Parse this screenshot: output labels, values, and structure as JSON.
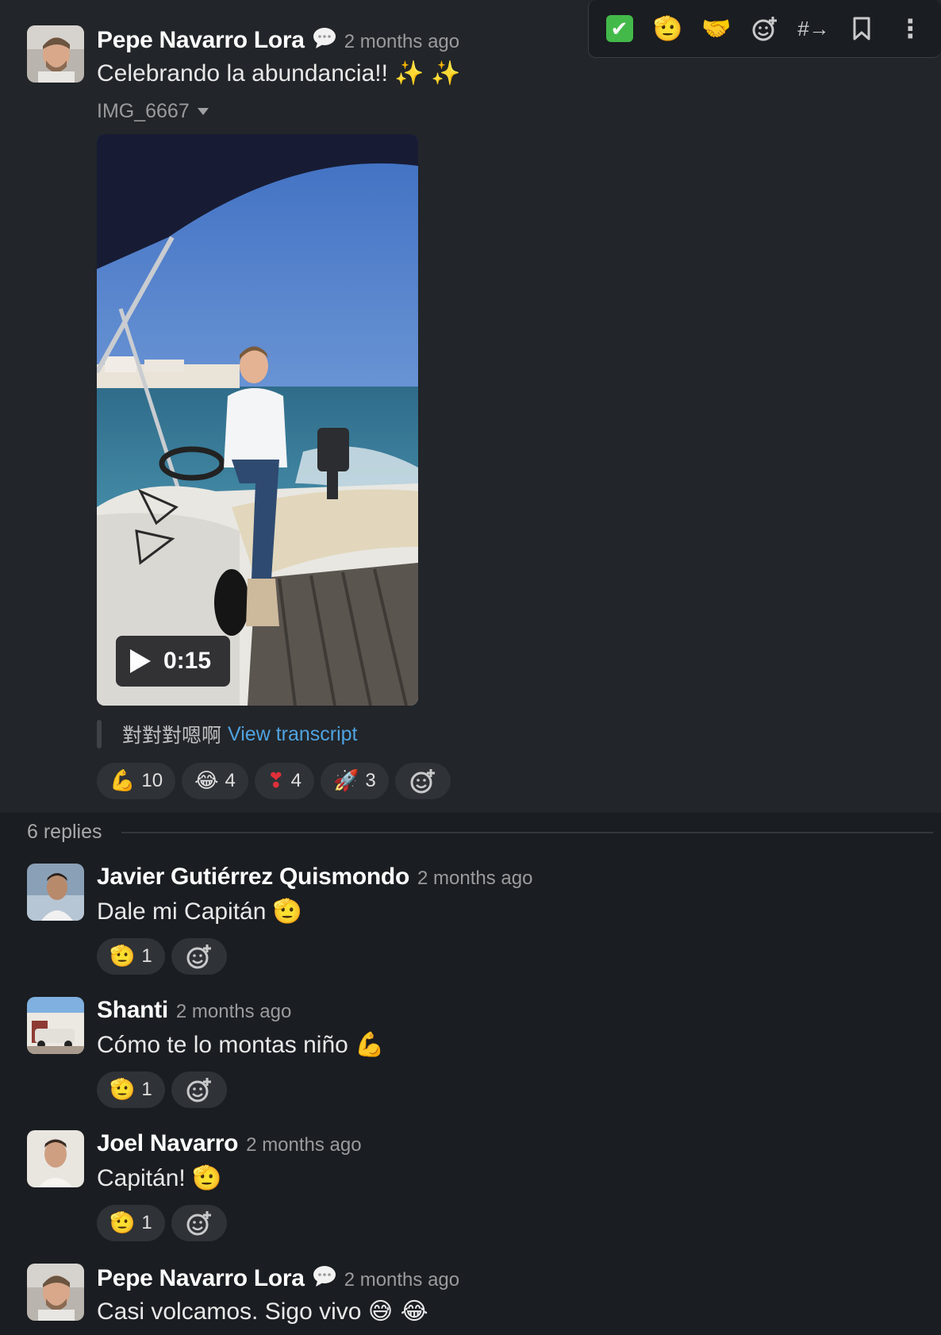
{
  "toolbar": {
    "items": [
      {
        "name": "checkmark",
        "glyph": "✔"
      },
      {
        "name": "salute",
        "glyph": "🫡"
      },
      {
        "name": "handshake",
        "glyph": "🤝"
      },
      {
        "name": "add-reaction",
        "glyph": "☺"
      },
      {
        "name": "forward-channel",
        "glyph": "#→"
      },
      {
        "name": "bookmark",
        "glyph": ""
      },
      {
        "name": "more-actions",
        "glyph": "⋮"
      }
    ]
  },
  "parent": {
    "author": "Pepe Navarro Lora",
    "time": "2 months ago",
    "text": "Celebrando la abundancia!! ✨ ✨",
    "file_name": "IMG_6667",
    "video_duration": "0:15",
    "transcript_preview": "對對對嗯啊",
    "transcript_link": "View transcript",
    "reactions": [
      {
        "emoji": "💪",
        "count": "10"
      },
      {
        "emoji": "😂",
        "count": "4"
      },
      {
        "emoji": "❣",
        "count": "4"
      },
      {
        "emoji": "🚀",
        "count": "3"
      }
    ]
  },
  "replies_label": "6 replies",
  "replies": [
    {
      "author": "Javier Gutiérrez Quismondo",
      "time": "2 months ago",
      "text": "Dale mi Capitán",
      "emoji": "🫡",
      "reaction": {
        "emoji": "🫡",
        "count": "1"
      }
    },
    {
      "author": "Shanti",
      "time": "2 months ago",
      "text": "Cómo te lo montas niño",
      "emoji": "💪",
      "reaction": {
        "emoji": "🫡",
        "count": "1"
      }
    },
    {
      "author": "Joel Navarro",
      "time": "2 months ago",
      "text": "Capitán!",
      "emoji": "🫡",
      "reaction": {
        "emoji": "🫡",
        "count": "1"
      }
    },
    {
      "author": "Pepe Navarro Lora",
      "time": "2 months ago",
      "text": "Casi volcamos. Sigo vivo",
      "emoji": "😅 😂",
      "reaction": null
    }
  ]
}
